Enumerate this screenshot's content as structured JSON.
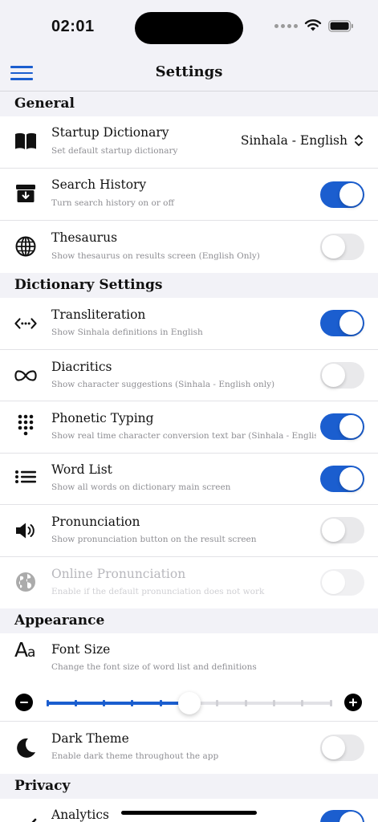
{
  "status_bar": {
    "time": "02:01"
  },
  "nav": {
    "title": "Settings"
  },
  "sections": {
    "general": "General",
    "dictionary": "Dictionary Settings",
    "appearance": "Appearance",
    "privacy": "Privacy"
  },
  "general": {
    "startup": {
      "title": "Startup Dictionary",
      "subtitle": "Set default startup dictionary",
      "value": "Sinhala - English"
    },
    "history": {
      "title": "Search History",
      "subtitle": "Turn search history on or off",
      "enabled": true
    },
    "thesaurus": {
      "title": "Thesaurus",
      "subtitle": "Show thesaurus on results screen (English Only)",
      "enabled": false
    }
  },
  "dictionary": {
    "transliteration": {
      "title": "Transliteration",
      "subtitle": "Show Sinhala definitions in English",
      "enabled": true
    },
    "diacritics": {
      "title": "Diacritics",
      "subtitle": "Show character suggestions (Sinhala - English only)",
      "enabled": false
    },
    "phonetic": {
      "title": "Phonetic Typing",
      "subtitle": "Show real time character conversion text bar (Sinhala - English on",
      "enabled": true
    },
    "wordlist": {
      "title": "Word List",
      "subtitle": "Show all words on dictionary main screen",
      "enabled": true
    },
    "pronunciation": {
      "title": "Pronunciation",
      "subtitle": "Show pronunciation button on the result screen",
      "enabled": false
    },
    "online_pronunciation": {
      "title": "Online Pronunciation",
      "subtitle": "Enable if the default pronunciation does not work",
      "enabled": false,
      "disabled": true
    }
  },
  "appearance": {
    "font_size": {
      "title": "Font Size",
      "subtitle": "Change the font size of word list and definitions",
      "level": 5,
      "max_level": 10
    },
    "dark_theme": {
      "title": "Dark Theme",
      "subtitle": "Enable dark theme throughout the app",
      "enabled": false
    }
  },
  "privacy": {
    "analytics": {
      "title": "Analytics",
      "enabled": true
    }
  },
  "colors": {
    "accent": "#1b5ecf",
    "background": "#f2f2f7",
    "row": "#ffffff",
    "subtitle": "#8e8e93"
  },
  "icons": {
    "menu": "hamburger-icon",
    "startup": "book-icon",
    "history": "archive-icon",
    "thesaurus": "globe-icon",
    "transliteration": "code-arrows-icon",
    "diacritics": "infinity-icon",
    "phonetic": "keypad-icon",
    "wordlist": "list-icon",
    "pronunciation": "speaker-icon",
    "online_pronunciation": "world-icon",
    "font_size": "text-size-icon",
    "dark_theme": "moon-icon",
    "analytics": "chart-icon"
  }
}
